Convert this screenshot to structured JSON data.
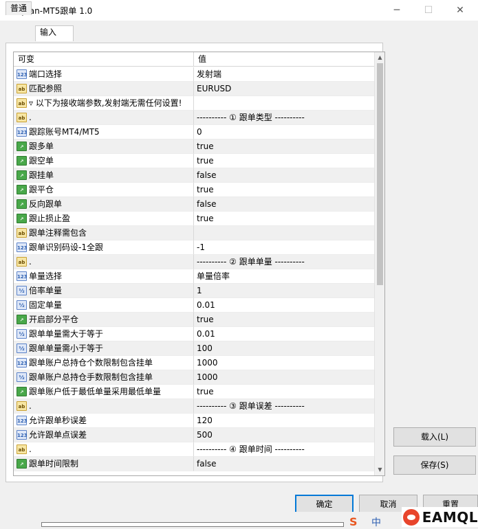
{
  "window": {
    "title": "tonlytan-MT5跟单 1.0",
    "minimize_glyph": "─",
    "maximize_glyph": "☐",
    "close_glyph": "✕"
  },
  "tabs": [
    {
      "label": "普通",
      "active": false
    },
    {
      "label": "输入",
      "active": true
    }
  ],
  "grid": {
    "header": {
      "col1": "可变",
      "col2": "值"
    },
    "rows": [
      {
        "type": "int",
        "name": "端口选择",
        "value": "发射端"
      },
      {
        "type": "str",
        "name": "匹配参照",
        "value": "EURUSD"
      },
      {
        "type": "str",
        "name": "▿ 以下为接收端参数,发射端无需任何设置!",
        "value": ""
      },
      {
        "type": "str",
        "name": ".",
        "value": "---------- ① 跟单类型 ----------"
      },
      {
        "type": "int",
        "name": "跟踪账号MT4/MT5",
        "value": "0"
      },
      {
        "type": "bool",
        "name": "跟多单",
        "value": "true"
      },
      {
        "type": "bool",
        "name": "跟空单",
        "value": "true"
      },
      {
        "type": "bool",
        "name": "跟挂单",
        "value": "false"
      },
      {
        "type": "bool",
        "name": "跟平仓",
        "value": "true"
      },
      {
        "type": "bool",
        "name": "反向跟单",
        "value": "false"
      },
      {
        "type": "bool",
        "name": "跟止损止盈",
        "value": "true"
      },
      {
        "type": "str",
        "name": "跟单注释需包含",
        "value": ""
      },
      {
        "type": "int",
        "name": "跟单识别码设-1全跟",
        "value": "-1"
      },
      {
        "type": "str",
        "name": ".",
        "value": "---------- ② 跟单单量 ----------"
      },
      {
        "type": "int",
        "name": "单量选择",
        "value": "单量倍率"
      },
      {
        "type": "dbl",
        "name": "倍率单量",
        "value": "1"
      },
      {
        "type": "dbl",
        "name": "固定单量",
        "value": "0.01"
      },
      {
        "type": "bool",
        "name": "开启部分平仓",
        "value": "true"
      },
      {
        "type": "dbl",
        "name": "跟单单量需大于等于",
        "value": "0.01"
      },
      {
        "type": "dbl",
        "name": "跟单单量需小于等于",
        "value": "100"
      },
      {
        "type": "int",
        "name": "跟单账户总持仓个数限制包含挂单",
        "value": "1000"
      },
      {
        "type": "dbl",
        "name": "跟单账户总持仓手数限制包含挂单",
        "value": "1000"
      },
      {
        "type": "bool",
        "name": "跟单账户低于最低单量采用最低单量",
        "value": "true"
      },
      {
        "type": "str",
        "name": ".",
        "value": "---------- ③ 跟单误差 ----------"
      },
      {
        "type": "int",
        "name": "允许跟单秒误差",
        "value": "120"
      },
      {
        "type": "int",
        "name": "允许跟单点误差",
        "value": "500"
      },
      {
        "type": "str",
        "name": ".",
        "value": "---------- ④ 跟单时间 ----------"
      },
      {
        "type": "bool",
        "name": "跟单时间限制",
        "value": "false"
      }
    ],
    "scroll_position": 0,
    "icon_text": {
      "int": "123",
      "str": "ab",
      "bool": "↗",
      "dbl": "½"
    }
  },
  "buttons": {
    "load": "载入(L)",
    "save": "保存(S)",
    "ok": "确定",
    "cancel": "取消",
    "reset": "重置"
  },
  "taskbar": {
    "ime_label": "中",
    "sogou_glyph": "S",
    "brand": "EAMQL"
  }
}
